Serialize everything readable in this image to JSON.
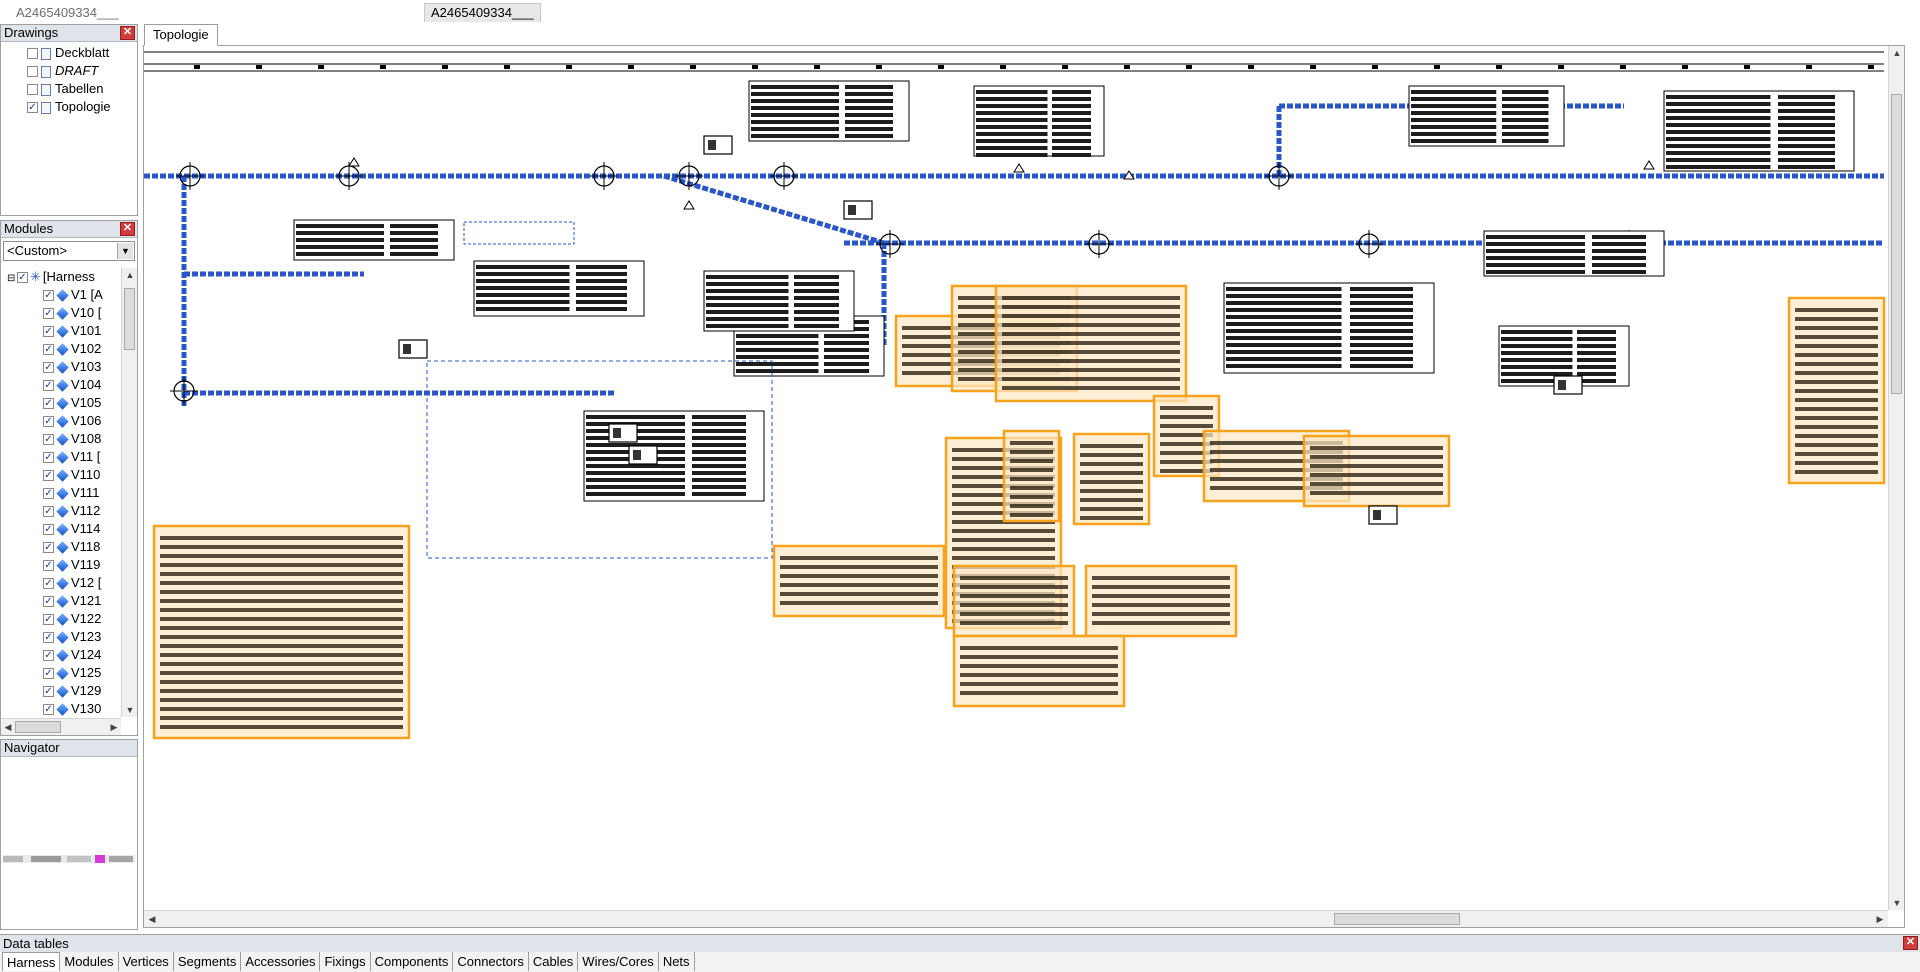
{
  "window": {
    "doc_title": "A2465409334___",
    "doc_tab": "A2465409334___"
  },
  "drawings": {
    "title": "Drawings",
    "items": [
      {
        "label": "Deckblatt",
        "checked": false
      },
      {
        "label": "DRAFT",
        "checked": false
      },
      {
        "label": "Tabellen",
        "checked": false
      },
      {
        "label": "Topologie",
        "checked": true
      }
    ]
  },
  "modules": {
    "title": "Modules",
    "filter": "<Custom>",
    "root": "[Harness",
    "items": [
      "V1 [A",
      "V10 [",
      "V101",
      "V102",
      "V103",
      "V104",
      "V105",
      "V106",
      "V108",
      "V11 [",
      "V110",
      "V111",
      "V112",
      "V114",
      "V118",
      "V119",
      "V12 [",
      "V121",
      "V122",
      "V123",
      "V124",
      "V125",
      "V129",
      "V130"
    ]
  },
  "navigator": {
    "title": "Navigator"
  },
  "canvas": {
    "tab": "Topologie"
  },
  "datatables": {
    "title": "Data tables",
    "tabs": [
      "Harness",
      "Modules",
      "Vertices",
      "Segments",
      "Accessories",
      "Fixings",
      "Components",
      "Connectors",
      "Cables",
      "Wires/Cores",
      "Nets"
    ],
    "active_tab": "Harness"
  },
  "colors": {
    "highlight": "#f7a21c",
    "highlight_fill": "#fde8c4",
    "wire": "#2a56c8"
  }
}
